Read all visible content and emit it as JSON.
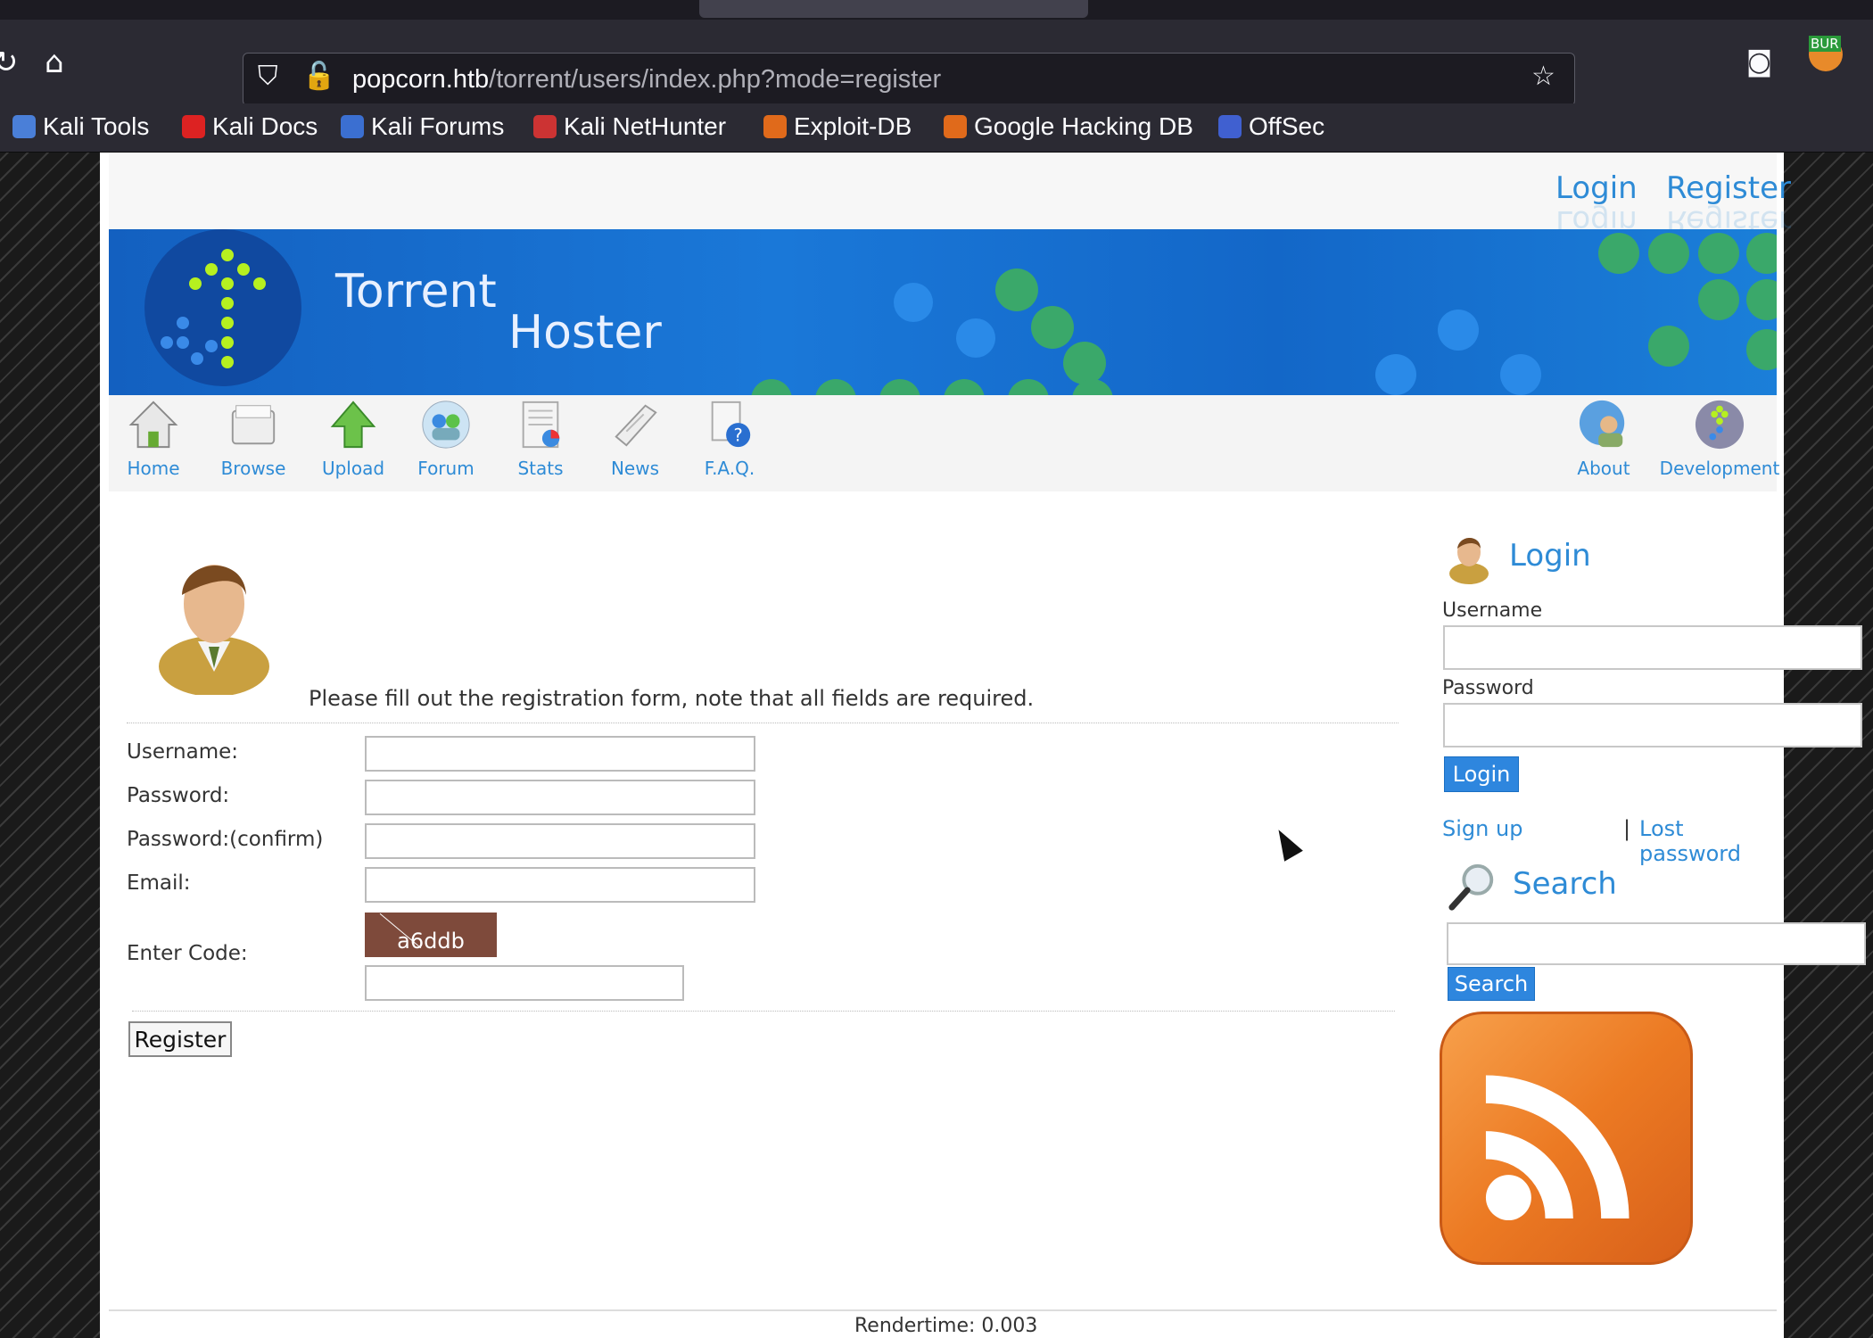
{
  "browser": {
    "url_host": "popcorn.htb",
    "url_path": "/torrent/users/index.php?mode=register",
    "bookmarks": [
      "Kali Tools",
      "Kali Docs",
      "Kali Forums",
      "Kali NetHunter",
      "Exploit-DB",
      "Google Hacking DB",
      "OffSec"
    ],
    "extension_badge": "BUR"
  },
  "header": {
    "links": {
      "login": "Login",
      "register": "Register"
    },
    "banner": {
      "title_line1": "Torrent",
      "title_line2": "Hoster"
    }
  },
  "nav": {
    "items": [
      "Home",
      "Browse",
      "Upload",
      "Forum",
      "Stats",
      "News",
      "F.A.Q."
    ],
    "right_items": [
      "About",
      "Development"
    ]
  },
  "registration": {
    "intro": "Please fill out the registration form, note that all fields are required.",
    "labels": {
      "username": "Username:",
      "password": "Password:",
      "password_confirm": "Password:(confirm)",
      "email": "Email:",
      "code": "Enter Code:"
    },
    "captcha_text": "a6ddb",
    "button": "Register"
  },
  "sidebar": {
    "login": {
      "heading": "Login",
      "username_label": "Username",
      "password_label": "Password",
      "button": "Login",
      "signup": "Sign up",
      "separator": "|",
      "lost_password": "Lost password"
    },
    "search": {
      "heading": "Search",
      "button": "Search"
    }
  },
  "footer": {
    "rendertime": "Rendertime: 0.003"
  },
  "colors": {
    "link": "#2e8bd6",
    "banner": "#1a78d8",
    "button": "#2e86de",
    "rss": "#ec7a23"
  }
}
